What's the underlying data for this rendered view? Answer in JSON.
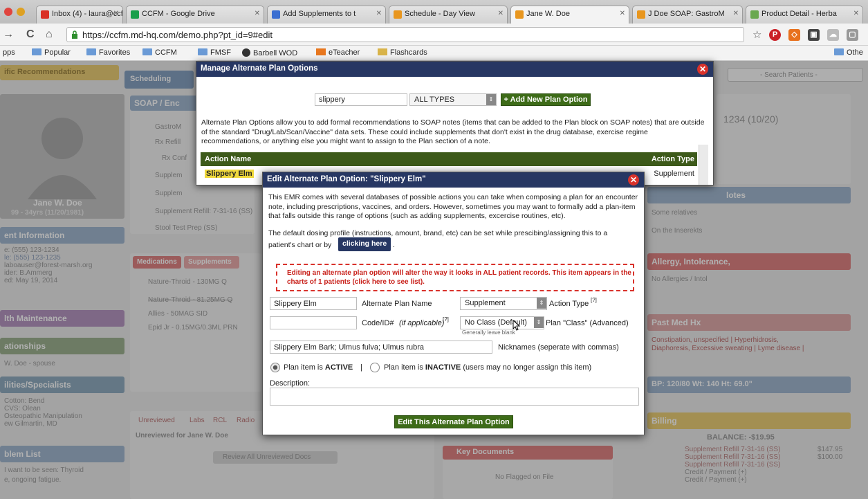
{
  "browser": {
    "tabs": [
      {
        "label": "Inbox (4) - laura@ccfm",
        "color": "#d93025"
      },
      {
        "label": "CCFM - Google Drive",
        "color": "#1a9f4b"
      },
      {
        "label": "Add Supplements to t",
        "color": "#3b6fd1"
      },
      {
        "label": "Schedule - Day View",
        "color": "#e8961e"
      },
      {
        "label": "Jane W. Doe",
        "color": "#e8961e"
      },
      {
        "label": "J Doe SOAP: GastroM",
        "color": "#e8961e"
      },
      {
        "label": "Product Detail - Herba",
        "color": "#6aa84f"
      }
    ],
    "url": "https://ccfm.md-hq.com/demo.php?pt_id=9#edit",
    "bookmarks": [
      "pps",
      "Popular",
      "Favorites",
      "CCFM",
      "FMSF",
      "Barbell WOD",
      "eTeacher",
      "Flashcards"
    ],
    "other_bookmarks": "Othe"
  },
  "background": {
    "specific_recs": "ific Recommendations",
    "scheduling": "Scheduling",
    "search": "- Search Patients -",
    "soap_header": "SOAP / Enc",
    "soap_items": [
      "GastroM",
      "Rx Refill",
      "Rx Conf",
      "Supplem",
      "Supplem",
      "Supplement Refill: 7-31-16 (SS)",
      "Stool Test Prep (SS)"
    ],
    "patient_name": "Jane W. Doe",
    "patient_sub": "99 - 34yrs (11/20/1981)",
    "patient_info": "ent Information",
    "patient_lines": [
      "e: (555) 123-1234",
      "le: (555) 123-1235",
      "",
      "laboauser@forest-marsh.org",
      "ider:   B.Ammerg",
      "ed: May 19, 2014"
    ],
    "health_maint": "lth Maintenance",
    "relationships": "ationships",
    "relation_line": "W. Doe - spouse",
    "specialists": "ilities/Specialists",
    "specialist_lines": [
      "Cotton: Bend",
      "CVS: Olean",
      "Osteopathic Manipulation",
      "ew Gilmartin, MD"
    ],
    "problem_list": "blem List",
    "problem_lines": [
      "I want to be seen: Thyroid",
      "e, ongoing fatigue."
    ],
    "med_tabs": [
      "Medications",
      "Supplements"
    ],
    "meds": [
      "Nature-Throid - 130MG Q",
      "Nature-Throid - 81.25MG Q",
      "Allies - 50MAG SID",
      "Epid Jr - 0.15MG/0.3ML PRN"
    ],
    "unreviewed_tabs": [
      "Unreviewed",
      "Labs",
      "RCL",
      "Radio"
    ],
    "unreviewed_for": "Unreviewed for Jane W. Doe",
    "review_all": "Review All Unreviewed Docs",
    "key_docs": "Key Documents",
    "no_flagged": "No Flagged on File",
    "right_header_code": "1234 (10/20)",
    "notes_header": "lotes",
    "notes_lines": [
      "Some relatives",
      "On the Inserekts"
    ],
    "allergy": "Allergy, Intolerance,",
    "allergy_sub": "No Allergies / Intol",
    "past_med": "Past Med Hx",
    "past_med_lines": [
      "Constipation, unspecified | Hyperhidrosis,",
      "Diaphoresis, Excessive sweating | Lyme disease |"
    ],
    "vitals": "BP: 120/80   Wt: 140   Ht: 69.0\"",
    "billing": "Billing",
    "balance": "BALANCE: -$19.95",
    "billing_rows": [
      "Supplement Refill 7-31-16 (SS)",
      "Supplement Refill 7-31-16 (SS)",
      "Supplement Refill 7-31-16 (SS)",
      "Credit / Payment (+)",
      "Credit / Payment (+)"
    ],
    "billing_amounts": [
      "",
      "",
      "",
      "$147.95",
      "$100.00"
    ]
  },
  "modal_manage": {
    "title": "Manage Alternate Plan Options",
    "search_value": "slippery",
    "type_select": "ALL TYPES",
    "add_button": "+ Add New Plan Option",
    "description": "Alternate Plan Options allow you to add formal recommendations to SOAP notes (items that can be added to the Plan block on SOAP notes) that are outside of the standard \"Drug/Lab/Scan/Vaccine\" data sets. These could include supplements that don't exist in the drug database, exercise regime recommendations, or anything else you might want to assign to the Plan section of a note.",
    "col_action_name": "Action Name",
    "col_action_type": "Action Type",
    "row_name": "Slippery Elm",
    "row_type": "Supplement"
  },
  "modal_edit": {
    "title": "Edit Alternate Plan Option: \"Slippery Elm\"",
    "intro": "This EMR comes with several databases of possible actions you can take when composing a plan for an encounter note, including prescriptions, vaccines, and orders. However, sometimes you may want to formally add a plan-item that falls outside this range of options (such as adding supplements, excercise routines, etc).",
    "dosing_line1": "The default dosing profile (instructions, amount, brand, etc) can be set while prescibing/assigning this to a",
    "dosing_line2": "patient's chart or by",
    "clicking_here": "clicking here",
    "period": ".",
    "warning": "Editing an alternate plan option will alter the way it looks in ALL patient records. This item appears in the charts of 1 patients (click here to see list).",
    "name_value": "Slippery Elm",
    "name_label": "Alternate Plan Name",
    "action_type_value": "Supplement",
    "action_type_label": "Action Type",
    "sup7": "[?]",
    "code_value": "",
    "code_label": "Code/ID#",
    "code_label_hint": "(if applicable)",
    "class_value": "No Class (Default)",
    "class_label": "Plan \"Class\" (Advanced)",
    "class_hint": "Generally leave blank",
    "nicknames_value": "Slippery Elm Bark; Ulmus fulva; Ulmus rubra",
    "nicknames_label": "Nicknames (seperate with commas)",
    "active_label_pre": "Plan item is ",
    "active_word": "ACTIVE",
    "separator": "|",
    "inactive_label_pre": "Plan item is ",
    "inactive_word": "INACTIVE",
    "inactive_label_post": " (users may no longer assign this item)",
    "description_label": "Description:",
    "description_value": "",
    "submit": "Edit This Alternate Plan Option"
  }
}
